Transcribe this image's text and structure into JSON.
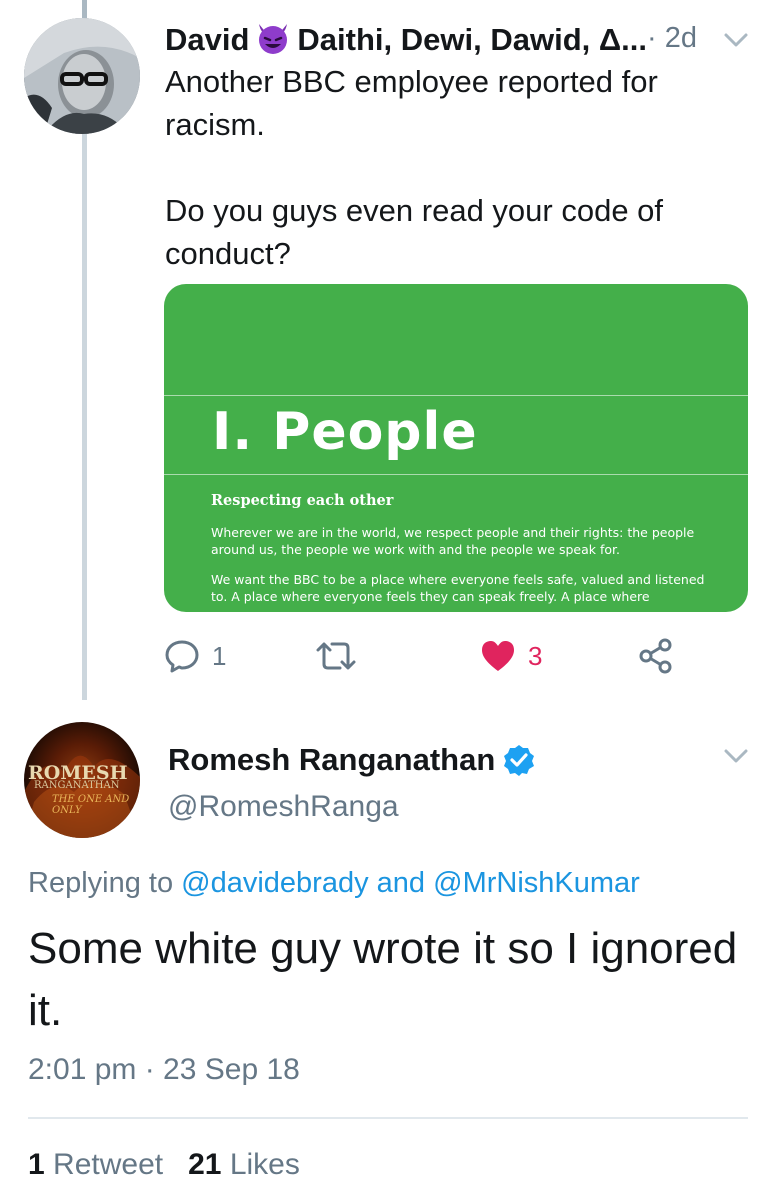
{
  "tweet1": {
    "display_name_first": "David",
    "display_name_rest": "Daithi, Dewi, Dawid, Δ...",
    "emoji": "smiling-devil-emoji",
    "time": "· 2d",
    "text": "Another BBC employee reported for racism.\n\nDo you guys even read your code of conduct?",
    "image": {
      "title": "I.  People",
      "subtitle": "Respecting each other",
      "para1": "Wherever we are in the world, we respect people and their rights: the people around us, the people we work with and the people we speak for.",
      "para2": "We want the BBC to be a place where everyone feels safe, valued and listened to. A place where everyone feels they can speak freely. A place where",
      "background": "#44af4a"
    },
    "actions": {
      "replies": "1",
      "retweets": "",
      "likes": "3"
    }
  },
  "tweet2": {
    "display_name": "Romesh Ranganathan",
    "handle": "@RomeshRanga",
    "avatar_text_a": "ROMESH",
    "avatar_text_b": "RANGANATHAN",
    "avatar_text_c": "THE ONE AND ONLY",
    "replying_prefix": "Replying to",
    "mention1": "@davidebrady",
    "conj": "and",
    "mention2": "@MrNishKumar",
    "text": "Some white guy wrote it so I ignored it.",
    "timestamp": "2:01 pm · 23 Sep 18",
    "retweet_count": "1",
    "retweet_label": "Retweet",
    "like_count": "21",
    "like_label": "Likes"
  },
  "colors": {
    "link": "#1b95e0",
    "muted": "#657786",
    "like": "#e0245e",
    "verified": "#1da1f2"
  }
}
